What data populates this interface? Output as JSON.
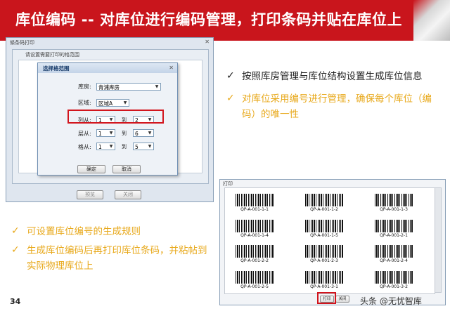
{
  "slide": {
    "title": "库位编码 -- 对库位进行编码管理，打印条码并贴在库位上",
    "page_number": "34",
    "watermark": "头条 @无忧智库"
  },
  "left_window": {
    "title": "條条码打印",
    "group_title": "请设置需要打印的格范围",
    "buttons": [
      "预览",
      "关闭"
    ]
  },
  "range_dialog": {
    "title": "选择格范围",
    "warehouse_label": "库房:",
    "warehouse_value": "青浦库房",
    "zone_label": "区域:",
    "zone_value": "区域A",
    "rows": [
      {
        "label": "列从:",
        "from": "1",
        "to_label": "到",
        "to": "2"
      },
      {
        "label": "层从:",
        "from": "1",
        "to_label": "到",
        "to": "6"
      },
      {
        "label": "格从:",
        "from": "1",
        "to_label": "到",
        "to": "5"
      }
    ],
    "ok_label": "确定",
    "cancel_label": "取消"
  },
  "right_bullets": [
    "按照库房管理与库位结构设置生成库位信息",
    "对库位采用编号进行管理，确保每个库位（编码）的唯一性"
  ],
  "left_bullets": [
    "可设置库位编号的生成规则",
    "生成库位编码后再打印库位条码，并粘帖到实际物理库位上"
  ],
  "print_window": {
    "title": "打印",
    "labels": [
      "QP-A-001-1-1",
      "QP-A-001-1-2",
      "QP-A-001-1-3",
      "QP-A-001-1-4",
      "QP-A-001-1-5",
      "QP-A-001-2-1",
      "QP-A-001-2-2",
      "QP-A-001-2-3",
      "QP-A-001-2-4",
      "QP-A-001-2-5",
      "QP-A-001-3-1",
      "QP-A-001-3-2"
    ],
    "print_label": "打印",
    "close_label": "关闭"
  },
  "colors": {
    "accent": "#c9151c",
    "highlight": "#e8a91c"
  }
}
